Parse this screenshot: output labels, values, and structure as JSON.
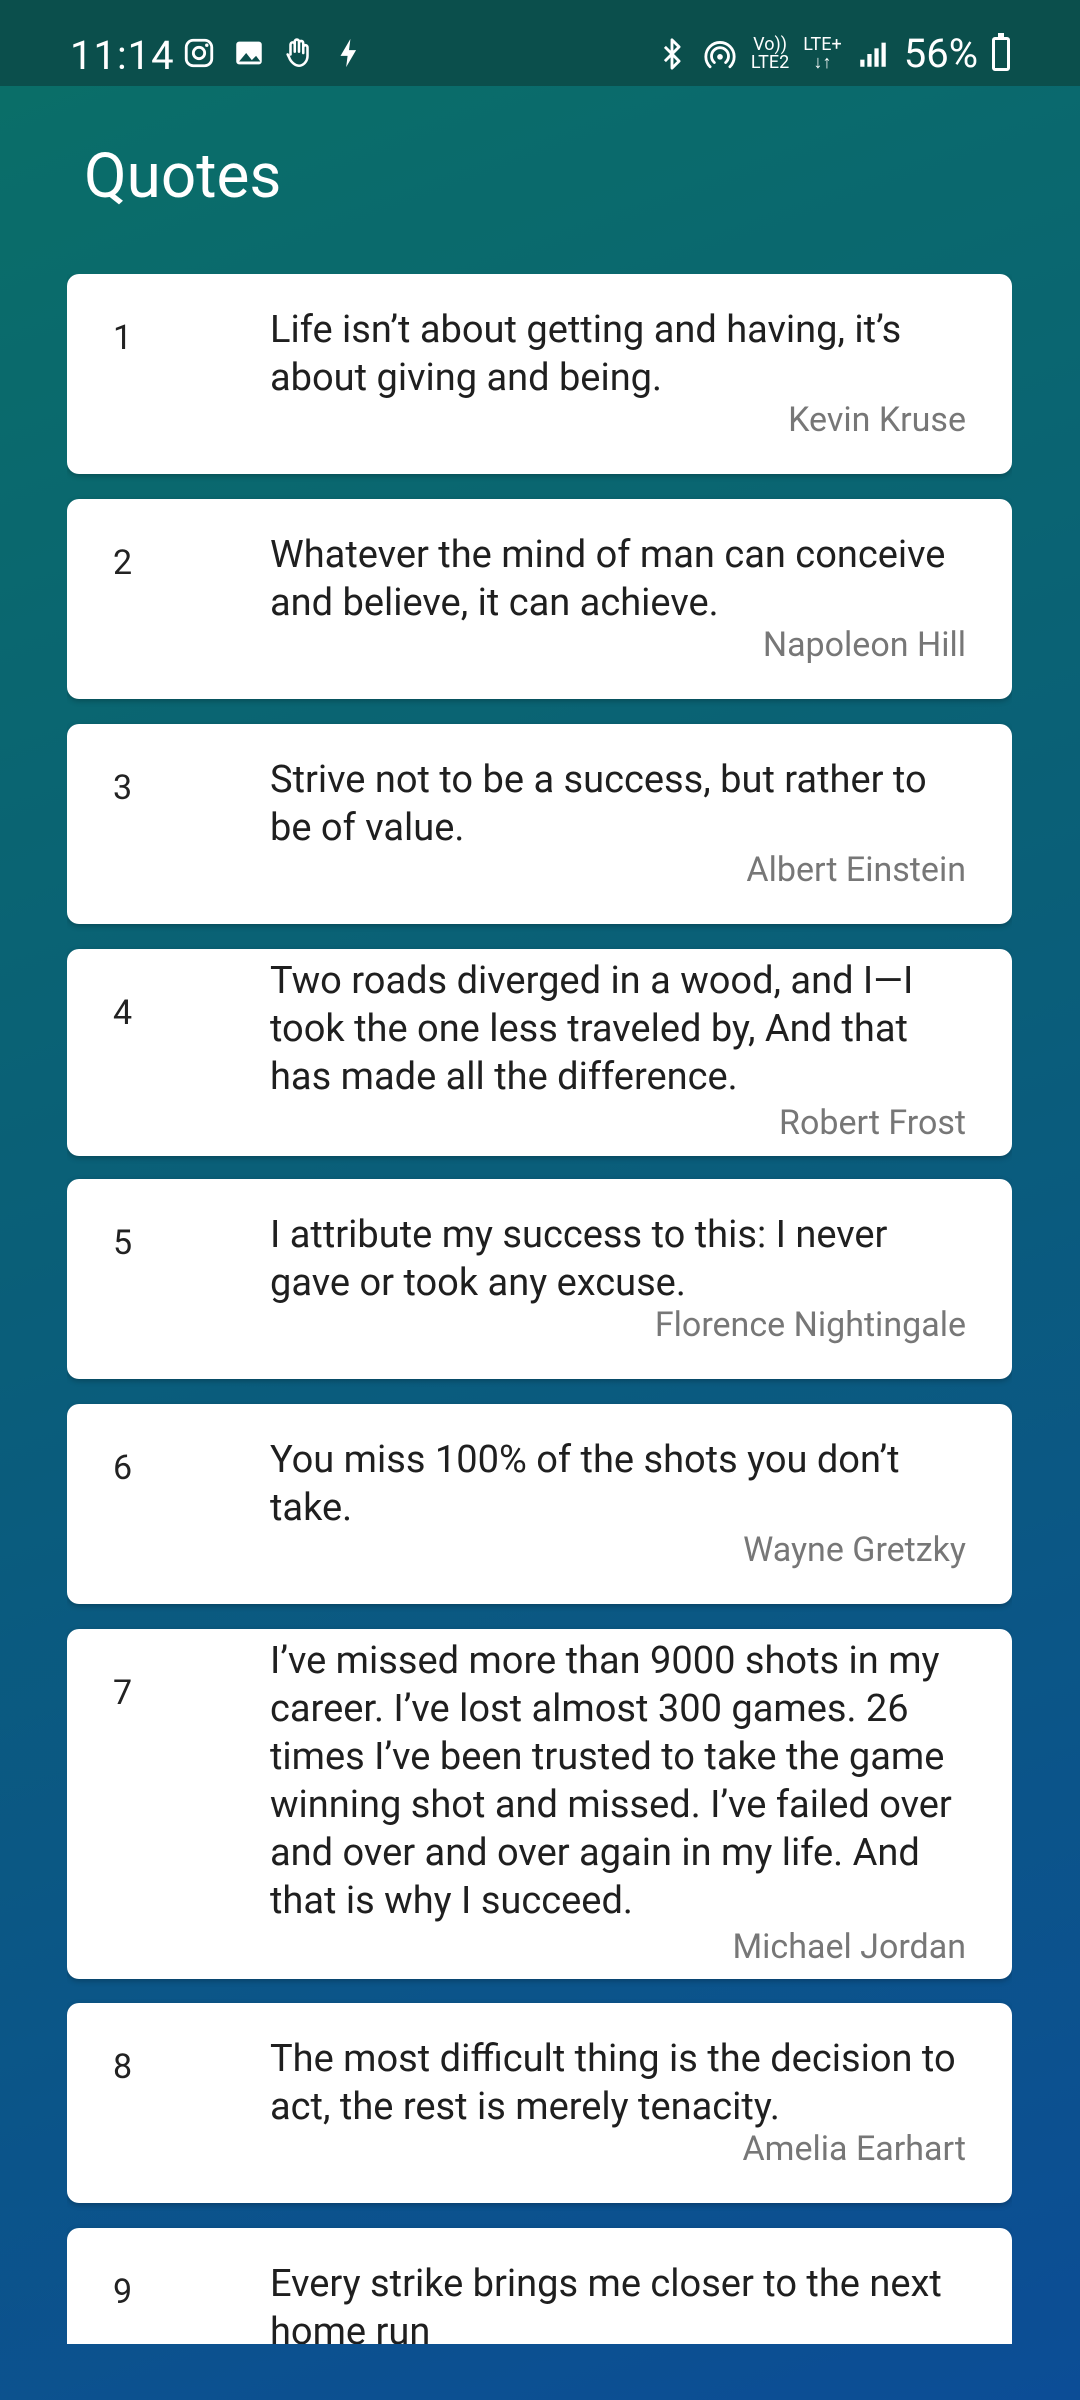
{
  "status": {
    "time": "11:14",
    "battery": "56%",
    "network_label_top": "Vo))",
    "network_label_bottom": "LTE2",
    "lte_label": "LTE+"
  },
  "app": {
    "title": "Quotes"
  },
  "quotes": [
    {
      "index": "1",
      "text": "Life isn’t about getting and having, it’s about giving and being.",
      "author": "Kevin Kruse"
    },
    {
      "index": "2",
      "text": "Whatever the mind of man can conceive and believe, it can achieve.",
      "author": "Napoleon Hill"
    },
    {
      "index": "3",
      "text": "Strive not to be a success, but rather to be of value.",
      "author": "Albert Einstein"
    },
    {
      "index": "4",
      "text": "Two roads diverged in a wood, and I—I took the one less traveled by, And that has made all the difference.",
      "author": "Robert Frost"
    },
    {
      "index": "5",
      "text": "I attribute my success to this: I never gave or took any excuse.",
      "author": "Florence Nightingale"
    },
    {
      "index": "6",
      "text": "You miss 100% of the shots you don’t take.",
      "author": "Wayne Gretzky"
    },
    {
      "index": "7",
      "text": "I’ve missed more than 9000 shots in my career. I’ve lost almost 300 games. 26 times I’ve been trusted to take the game winning shot and missed. I’ve failed over and over and over again in my life. And that is why I succeed.",
      "author": "Michael Jordan"
    },
    {
      "index": "8",
      "text": "The most difficult thing is the decision to act, the rest is merely tenacity.",
      "author": "Amelia Earhart"
    },
    {
      "index": "9",
      "text": "Every strike brings me closer to the next home run",
      "author": ""
    }
  ]
}
